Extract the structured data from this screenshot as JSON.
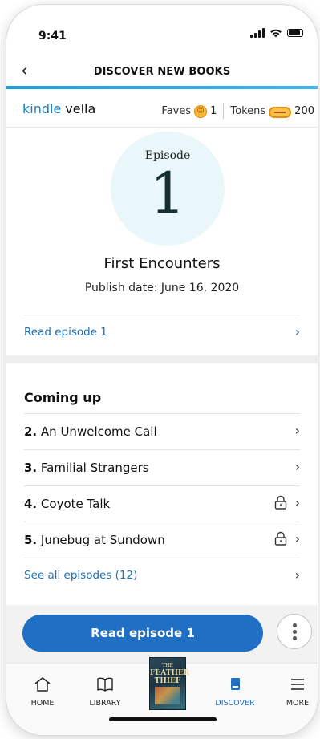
{
  "status_bar": {
    "time": "9:41"
  },
  "header": {
    "title": "DISCOVER NEW BOOKS"
  },
  "brand": {
    "kindle": "kindle",
    "vella": "vella"
  },
  "stats": {
    "faves_label": "Faves",
    "faves_count": "1",
    "tokens_label": "Tokens",
    "tokens_count": "200"
  },
  "episode": {
    "label": "Episode",
    "number": "1",
    "title": "First Encounters",
    "publish_date": "Publish date: June 16, 2020",
    "read_link": "Read episode 1"
  },
  "coming_up": {
    "heading": "Coming up",
    "items": [
      {
        "num": "2.",
        "title": "An Unwelcome Call",
        "locked": false
      },
      {
        "num": "3.",
        "title": "Familial Strangers",
        "locked": false
      },
      {
        "num": "4.",
        "title": "Coyote Talk",
        "locked": true
      },
      {
        "num": "5.",
        "title": "Junebug at Sundown",
        "locked": true
      }
    ],
    "see_all": "See all episodes (12)"
  },
  "action": {
    "read_button": "Read episode 1"
  },
  "tabbar": {
    "home": "HOME",
    "library": "LIBRARY",
    "cover_line1": "THE",
    "cover_line2": "FEATHER THIEF",
    "discover": "DISCOVER",
    "more": "MORE"
  },
  "colors": {
    "accent": "#1f6fc4",
    "brand_blue": "#1d7fc1",
    "hero_bg": "#e9f7fb",
    "token_orange": "#e58c12"
  }
}
